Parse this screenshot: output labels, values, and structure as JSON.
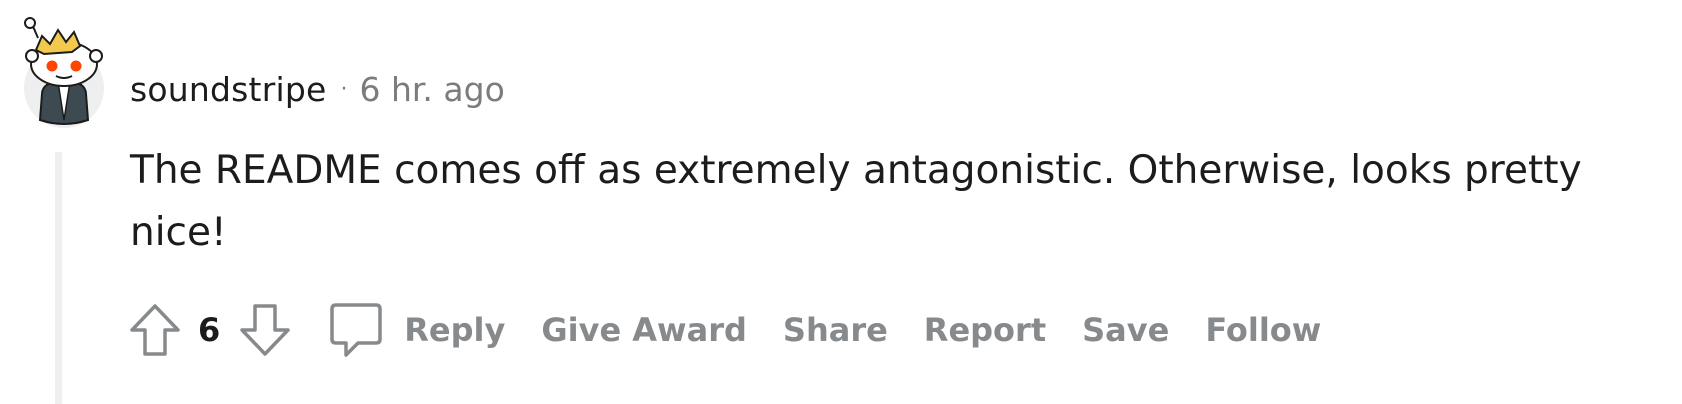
{
  "comment": {
    "author": "soundstripe",
    "separator": "·",
    "timestamp": "6 hr. ago",
    "text": "The README comes off as extremely antagonistic. Otherwise, looks pretty nice!",
    "score": "6"
  },
  "actions": {
    "reply": "Reply",
    "give_award": "Give Award",
    "share": "Share",
    "report": "Report",
    "save": "Save",
    "follow": "Follow"
  },
  "icons": {
    "upvote": "upvote-arrow-icon",
    "downvote": "downvote-arrow-icon",
    "reply": "speech-bubble-icon",
    "avatar": "snoo-avatar-crown"
  },
  "colors": {
    "text": "#1c1c1c",
    "muted": "#7c7c7c",
    "action_label": "#878a8c",
    "icon_stroke": "#878a8c",
    "thread_line": "#edeff1",
    "avatar_eye": "#ff4500"
  }
}
